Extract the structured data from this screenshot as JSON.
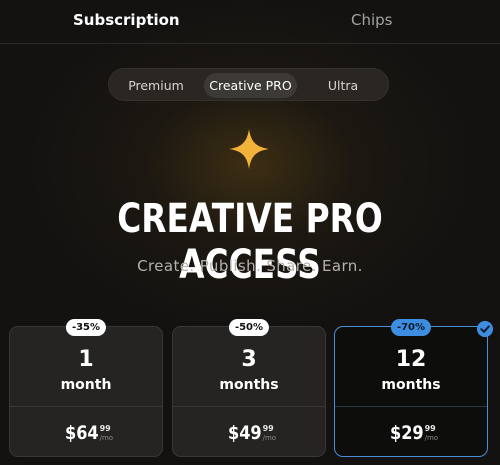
{
  "top_tabs": {
    "subscription": "Subscription",
    "chips": "Chips"
  },
  "plans": {
    "premium": "Premium",
    "creative_pro": "Creative PRO",
    "ultra": "Ultra"
  },
  "hero": {
    "title": "CREATIVE PRO ACCESS",
    "subtitle": "Create. Publish. Share. Earn.",
    "icon": "sparkle-icon"
  },
  "cards": [
    {
      "badge": "-35%",
      "num": "1",
      "unit": "month",
      "price": "$64",
      "cents": "99",
      "per": "/mo"
    },
    {
      "badge": "-50%",
      "num": "3",
      "unit": "months",
      "price": "$49",
      "cents": "99",
      "per": "/mo"
    },
    {
      "badge": "-70%",
      "num": "12",
      "unit": "months",
      "price": "$29",
      "cents": "99",
      "per": "/mo",
      "selected": true
    }
  ],
  "colors": {
    "accent": "#3d8ee0",
    "sparkle": "#f3b23a",
    "background": "#131211"
  }
}
